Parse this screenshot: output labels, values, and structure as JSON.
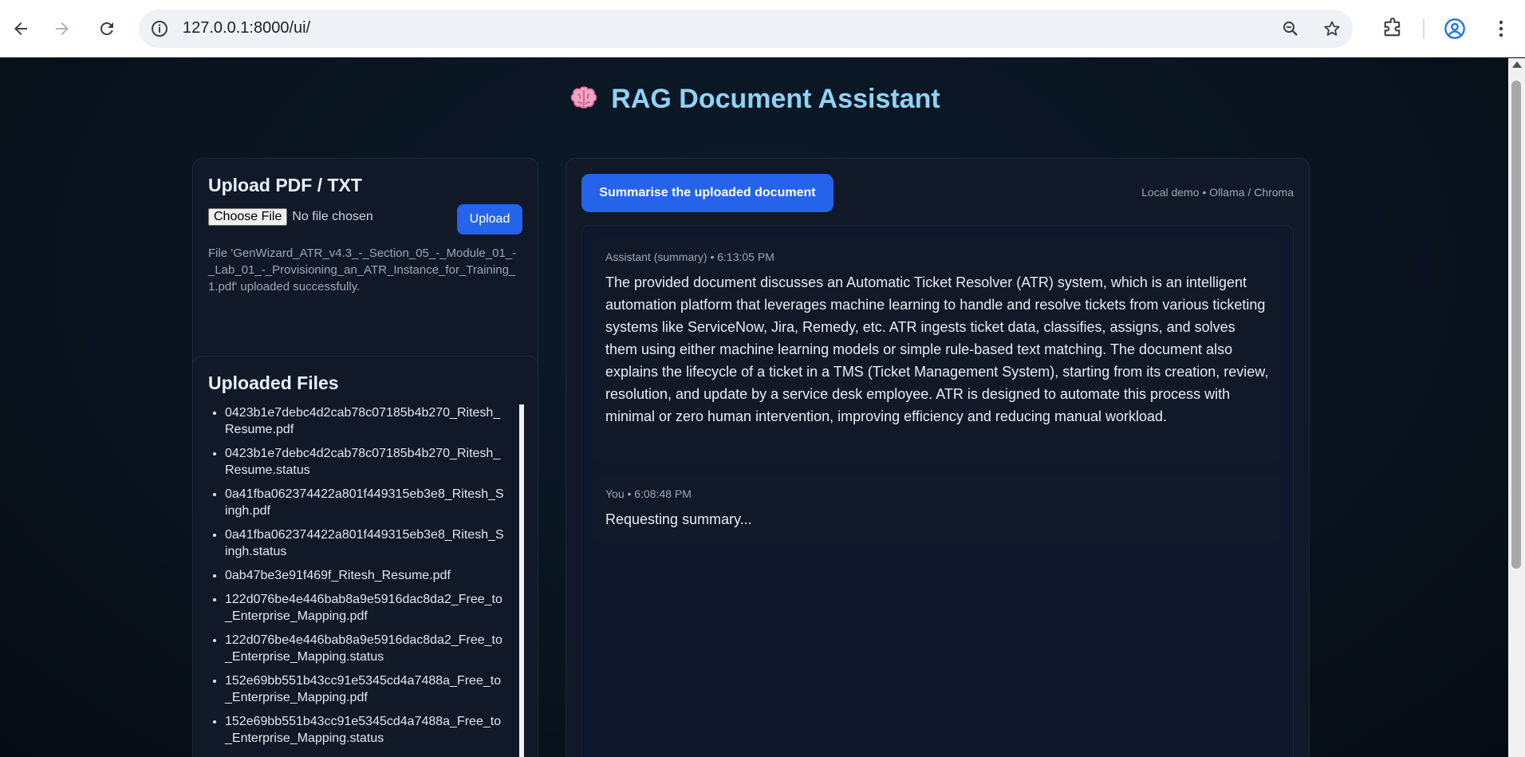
{
  "browser": {
    "url": "127.0.0.1:8000/ui/"
  },
  "page": {
    "title": "RAG Document Assistant"
  },
  "upload": {
    "heading": "Upload PDF / TXT",
    "choose_label": "Choose File",
    "no_file": "No file chosen",
    "upload_label": "Upload",
    "status": "File 'GenWizard_ATR_v4.3_-_Section_05_-_Module_01_-_Lab_01_-_Provisioning_an_ATR_Instance_for_Training_1.pdf' uploaded successfully."
  },
  "files": {
    "heading": "Uploaded Files",
    "items": [
      "0423b1e7debc4d2cab78c07185b4b270_Ritesh_Resume.pdf",
      "0423b1e7debc4d2cab78c07185b4b270_Ritesh_Resume.status",
      "0a41fba062374422a801f449315eb3e8_Ritesh_Singh.pdf",
      "0a41fba062374422a801f449315eb3e8_Ritesh_Singh.status",
      "0ab47be3e91f469f_Ritesh_Resume.pdf",
      "122d076be4e446bab8a9e5916dac8da2_Free_to_Enterprise_Mapping.pdf",
      "122d076be4e446bab8a9e5916dac8da2_Free_to_Enterprise_Mapping.status",
      "152e69bb551b43cc91e5345cd4a7488a_Free_to_Enterprise_Mapping.pdf",
      "152e69bb551b43cc91e5345cd4a7488a_Free_to_Enterprise_Mapping.status"
    ]
  },
  "chat": {
    "summarise_label": "Summarise the uploaded document",
    "meta": "Local demo • Ollama / Chroma",
    "messages": [
      {
        "who": "Assistant (summary) • 6:13:05 PM",
        "text": "The provided document discusses an Automatic Ticket Resolver (ATR) system, which is an intelligent automation platform that leverages machine learning to handle and resolve tickets from various ticketing systems like ServiceNow, Jira, Remedy, etc. ATR ingests ticket data, classifies, assigns, and solves them using either machine learning models or simple rule-based text matching. The document also explains the lifecycle of a ticket in a TMS (Ticket Management System), starting from its creation, review, resolution, and update by a service desk employee. ATR is designed to automate this process with minimal or zero human intervention, improving efficiency and reducing manual workload."
      },
      {
        "who": "You • 6:08:48 PM",
        "text": "Requesting summary..."
      }
    ]
  }
}
